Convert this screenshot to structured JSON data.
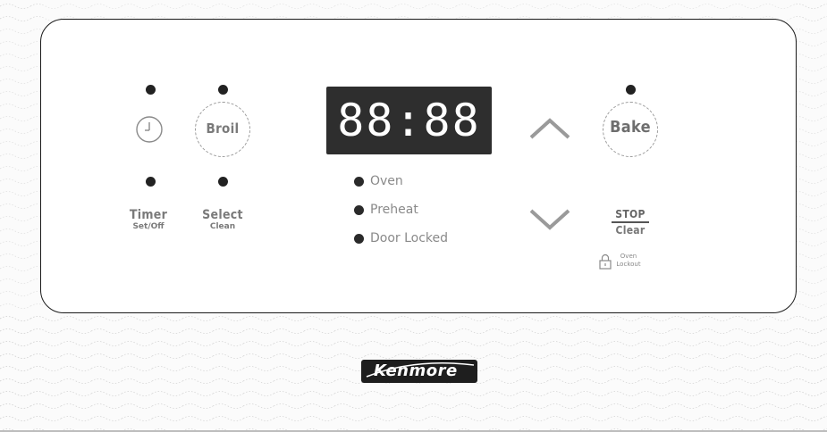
{
  "controls": {
    "timer_icon": "clock-icon",
    "broil_label": "Broil",
    "bake_label": "Bake",
    "timer_label": "Timer",
    "timer_sub": "Set/Off",
    "select_label": "Select",
    "select_sub": "Clean",
    "stop_label": "STOP",
    "clear_label": "Clear",
    "lock_icon": "padlock-icon",
    "lockout_line1": "Oven",
    "lockout_line2": "Lockout",
    "up_icon": "chevron-up-icon",
    "down_icon": "chevron-down-icon"
  },
  "display": {
    "digits": "88:88"
  },
  "indicators": [
    {
      "label": "Oven"
    },
    {
      "label": "Preheat"
    },
    {
      "label": "Door Locked"
    }
  ],
  "brand": {
    "name": "Kenmore"
  },
  "colors": {
    "display_bg": "#2e2e2e",
    "indicator_dot": "#222222",
    "label_text": "#7a7a7a",
    "panel_border": "#1a1a1a"
  }
}
